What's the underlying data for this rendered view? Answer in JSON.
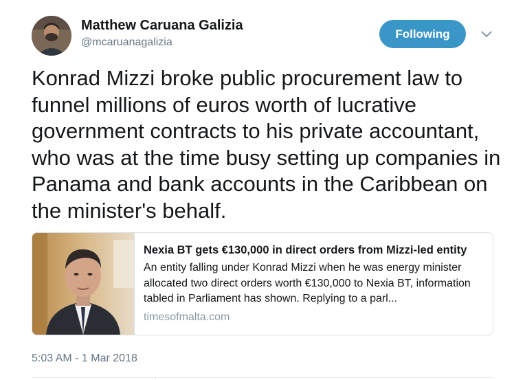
{
  "author": {
    "name": "Matthew Caruana Galizia",
    "handle": "@mcaruanagalizia",
    "avatar_icon": "profile-photo"
  },
  "follow_button": {
    "label": "Following",
    "color": "#3b96c8"
  },
  "menu": {
    "icon": "chevron-down-icon"
  },
  "tweet": {
    "text": "Konrad Mizzi broke public procurement law to funnel millions of euros worth of lucrative government contracts to his private accountant, who was at the time busy setting up companies in Panama and bank accounts in the Caribbean on the minister's behalf."
  },
  "card": {
    "title": "Nexia BT gets €130,000 in direct orders from Mizzi-led entity",
    "description": "An entity falling under Konrad Mizzi when he was energy minister allocated two direct orders worth €130,000 to Nexia BT, information tabled in Parliament has shown. Replying to a parl...",
    "domain": "timesofmalta.com",
    "image_icon": "news-photo"
  },
  "timestamp": "5:03 AM - 1 Mar 2018"
}
